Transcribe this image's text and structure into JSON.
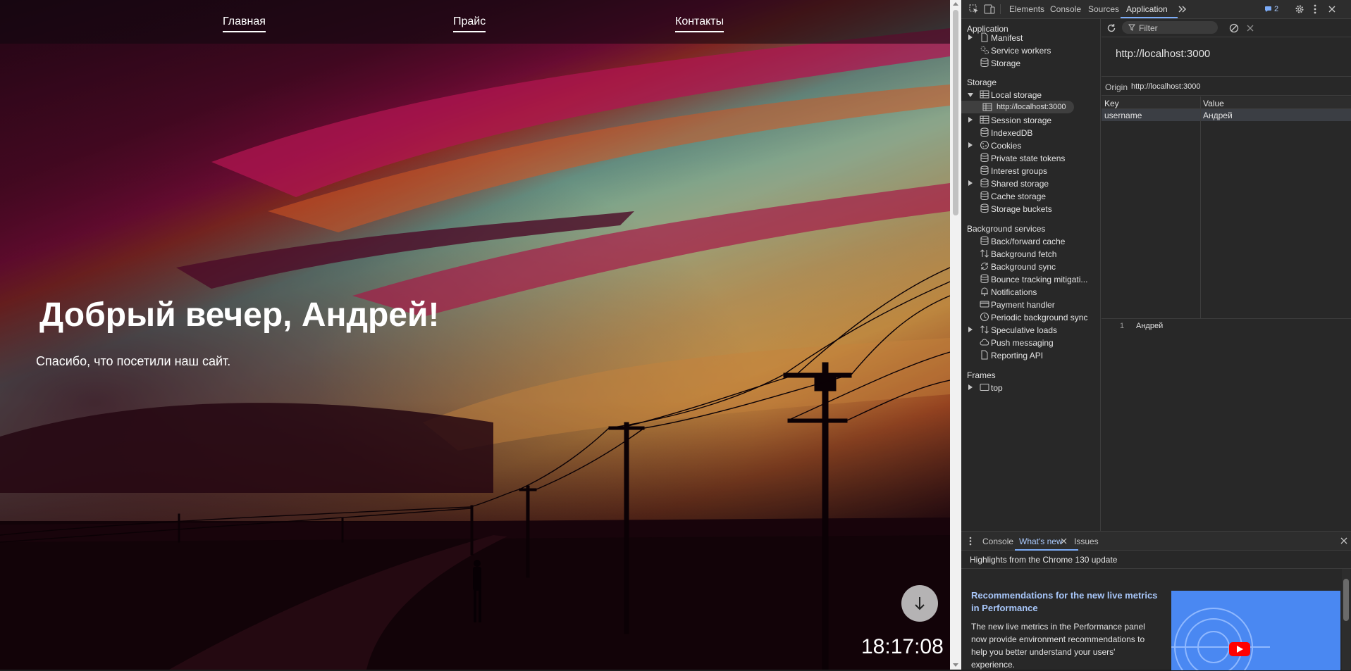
{
  "site": {
    "nav": {
      "home": "Главная",
      "pricing": "Прайс",
      "contacts": "Контакты"
    },
    "greeting": "Добрый вечер, Андрей!",
    "subtitle": "Спасибо, что посетили наш сайт.",
    "clock": "18:17:08"
  },
  "devtools": {
    "tabs": [
      "Elements",
      "Console",
      "Sources",
      "Application"
    ],
    "active_tab": "Application",
    "issues_count": "2",
    "sidebar": {
      "application_header": "Application",
      "application_items": [
        "Manifest",
        "Service workers",
        "Storage"
      ],
      "storage_header": "Storage",
      "storage_items": [
        "Local storage",
        "http://localhost:3000",
        "Session storage",
        "IndexedDB",
        "Cookies",
        "Private state tokens",
        "Interest groups",
        "Shared storage",
        "Cache storage",
        "Storage buckets"
      ],
      "background_header": "Background services",
      "background_items": [
        "Back/forward cache",
        "Background fetch",
        "Background sync",
        "Bounce tracking mitigati...",
        "Notifications",
        "Payment handler",
        "Periodic background sync",
        "Speculative loads",
        "Push messaging",
        "Reporting API"
      ],
      "frames_header": "Frames",
      "frames_items": [
        "top"
      ]
    },
    "main": {
      "filter_placeholder": "Filter",
      "origin_title": "http://localhost:3000",
      "origin_label": "Origin",
      "origin_value": "http://localhost:3000",
      "columns": [
        "Key",
        "Value"
      ],
      "rows": [
        {
          "key": "username",
          "value": "Андрей"
        }
      ],
      "preview_line_number": "1",
      "preview_value": "Андрей"
    },
    "drawer": {
      "tabs": [
        "Console",
        "What's new",
        "Issues"
      ],
      "active_tab": "What's new",
      "highlights": "Highlights from the Chrome 130 update",
      "article_title": "Recommendations for the new live metrics in Performance",
      "article_body": "The new live metrics in the Performance panel now provide environment recommendations to help you better understand your users' experience."
    },
    "colors": {
      "accent": "#7cacf8",
      "link": "#a8c7fa",
      "panel_bg": "#282828"
    }
  }
}
